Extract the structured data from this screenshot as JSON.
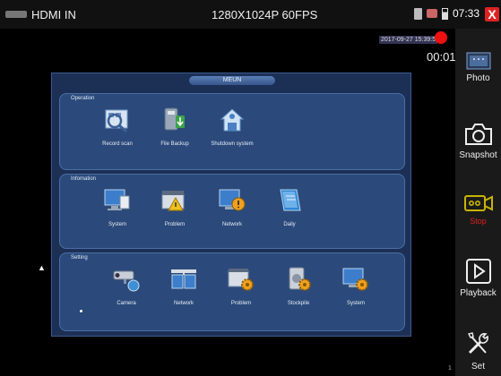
{
  "status_bar": {
    "source": "HDMI IN",
    "resolution": "1280X1024P 60FPS",
    "time": "07:33",
    "close_label": "X"
  },
  "video": {
    "timestamp": "2017-09-27 15:39:5",
    "timer": "00:01",
    "frame_index": "1"
  },
  "menu": {
    "title": "MEUN",
    "sections": [
      {
        "label": "Operation",
        "items": [
          "Record scan",
          "File Backup",
          "Shutdown system"
        ]
      },
      {
        "label": "Infomation",
        "items": [
          "System",
          "Problem",
          "Network",
          "Daily"
        ]
      },
      {
        "label": "Setting",
        "items": [
          "Camera",
          "Network",
          "Problem",
          "Stockpile",
          "System"
        ]
      }
    ]
  },
  "sidebar": {
    "photo": "Photo",
    "snapshot": "Snapshot",
    "stop": "Stop",
    "playback": "Playback",
    "set": "Set"
  },
  "colors": {
    "record_red": "#e11111",
    "close_red": "#dd2222",
    "menu_bg": "#1c2f55",
    "section_bg": "#2b4a7b",
    "stop_icon": "#c8b400"
  }
}
